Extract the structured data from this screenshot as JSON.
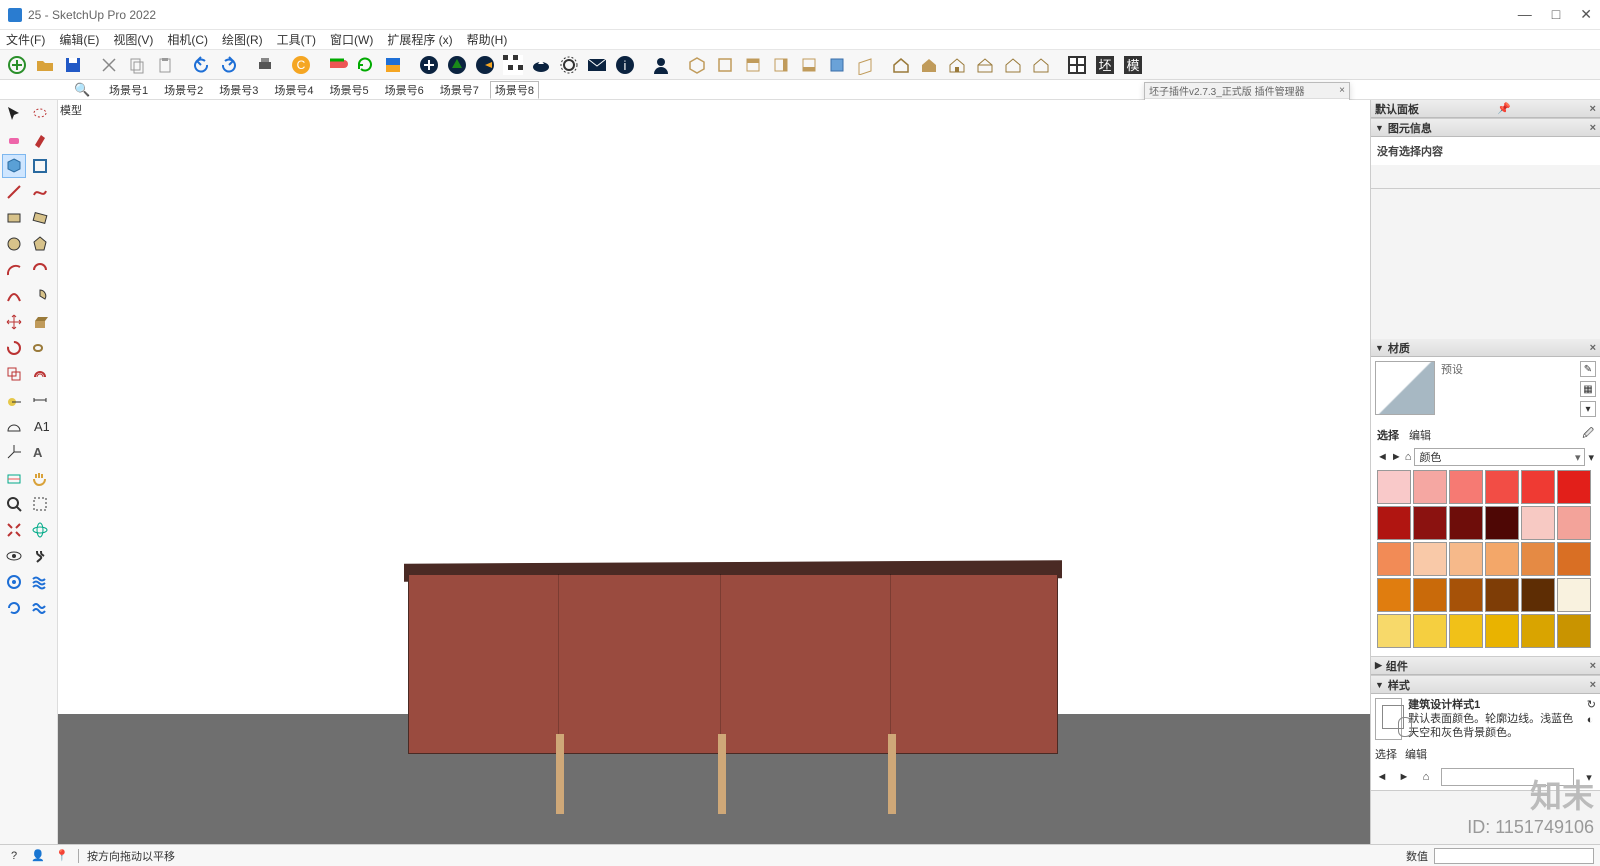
{
  "app": {
    "title": "25 - SketchUp Pro 2022"
  },
  "win": {
    "min": "—",
    "max": "□",
    "close": "✕"
  },
  "menu": [
    "文件(F)",
    "编辑(E)",
    "视图(V)",
    "相机(C)",
    "绘图(R)",
    "工具(T)",
    "窗口(W)",
    "扩展程序 (x)",
    "帮助(H)"
  ],
  "scenes": {
    "items": [
      "场景号1",
      "场景号2",
      "场景号3",
      "场景号4",
      "场景号5",
      "场景号6",
      "场景号7",
      "场景号8"
    ],
    "active": 7,
    "viewportLabel": "模型"
  },
  "floating": {
    "title": "坯子插件v2.7.3_正式版 插件管理器",
    "search_placeholder": ""
  },
  "tray": {
    "defaultPanel": "默认面板",
    "entity": {
      "title": "图元信息",
      "empty": "没有选择内容"
    },
    "materials": {
      "title": "材质",
      "preset": "预设",
      "tab_select": "选择",
      "tab_edit": "编辑",
      "category": "颜色",
      "swatches": [
        "#f9c9c9",
        "#f5a7a2",
        "#f67a73",
        "#f24d45",
        "#ef3a33",
        "#e21f1a",
        "#b01511",
        "#8b1210",
        "#6e0d0a",
        "#4e0705",
        "#f7c9c3",
        "#f3a39a",
        "#f28b56",
        "#f9c9a8",
        "#f6b98a",
        "#f3a769",
        "#e58a44",
        "#d96f24",
        "#e07d0f",
        "#c96a0a",
        "#a65208",
        "#7e3d06",
        "#5e2d04",
        "#f9f2df",
        "#f7d96a",
        "#f5cf40",
        "#f1c118",
        "#e9b300",
        "#d9a400",
        "#c99400"
      ]
    },
    "components": {
      "title": "组件"
    },
    "styles": {
      "title": "样式",
      "name": "建筑设计样式1",
      "desc": "默认表面颜色。轮廓边线。浅蓝色天空和灰色背景颜色。",
      "tab_select": "选择",
      "tab_edit": "编辑"
    }
  },
  "status": {
    "hint": "按方向拖动以平移",
    "valueLabel": "数值"
  },
  "watermark": {
    "brand": "知末",
    "id": "ID: 1151749106"
  }
}
